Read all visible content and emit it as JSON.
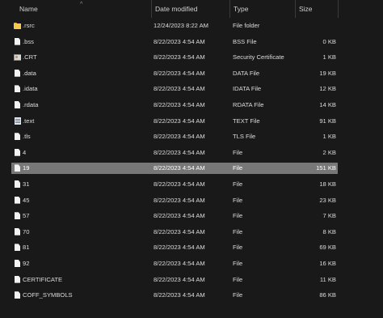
{
  "header": {
    "name": "Name",
    "date_modified": "Date modified",
    "type": "Type",
    "size": "Size",
    "sort_arrow": "^"
  },
  "files": [
    {
      "icon": "folder-icon",
      "name": ".rsrc",
      "date": "12/24/2023 8:22 AM",
      "type": "File folder",
      "size": ""
    },
    {
      "icon": "file-icon",
      "name": ".bss",
      "date": "8/22/2023 4:54 AM",
      "type": "BSS File",
      "size": "0 KB"
    },
    {
      "icon": "certificate-icon",
      "name": ".CRT",
      "date": "8/22/2023 4:54 AM",
      "type": "Security Certificate",
      "size": "1 KB"
    },
    {
      "icon": "file-icon",
      "name": ".data",
      "date": "8/22/2023 4:54 AM",
      "type": "DATA File",
      "size": "19 KB"
    },
    {
      "icon": "file-icon",
      "name": ".idata",
      "date": "8/22/2023 4:54 AM",
      "type": "IDATA File",
      "size": "12 KB"
    },
    {
      "icon": "file-icon",
      "name": ".rdata",
      "date": "8/22/2023 4:54 AM",
      "type": "RDATA File",
      "size": "14 KB"
    },
    {
      "icon": "text-file-icon",
      "name": ".text",
      "date": "8/22/2023 4:54 AM",
      "type": "TEXT File",
      "size": "91 KB"
    },
    {
      "icon": "file-icon",
      "name": ".tls",
      "date": "8/22/2023 4:54 AM",
      "type": "TLS File",
      "size": "1 KB"
    },
    {
      "icon": "file-icon",
      "name": "4",
      "date": "8/22/2023 4:54 AM",
      "type": "File",
      "size": "2 KB"
    },
    {
      "icon": "file-icon",
      "name": "19",
      "date": "8/22/2023 4:54 AM",
      "type": "File",
      "size": "151 KB",
      "selected": true
    },
    {
      "icon": "file-icon",
      "name": "31",
      "date": "8/22/2023 4:54 AM",
      "type": "File",
      "size": "18 KB"
    },
    {
      "icon": "file-icon",
      "name": "45",
      "date": "8/22/2023 4:54 AM",
      "type": "File",
      "size": "23 KB"
    },
    {
      "icon": "file-icon",
      "name": "57",
      "date": "8/22/2023 4:54 AM",
      "type": "File",
      "size": "7 KB"
    },
    {
      "icon": "file-icon",
      "name": "70",
      "date": "8/22/2023 4:54 AM",
      "type": "File",
      "size": "8 KB"
    },
    {
      "icon": "file-icon",
      "name": "81",
      "date": "8/22/2023 4:54 AM",
      "type": "File",
      "size": "69 KB"
    },
    {
      "icon": "file-icon",
      "name": "92",
      "date": "8/22/2023 4:54 AM",
      "type": "File",
      "size": "16 KB"
    },
    {
      "icon": "file-icon",
      "name": "CERTIFICATE",
      "date": "8/22/2023 4:54 AM",
      "type": "File",
      "size": "11 KB"
    },
    {
      "icon": "file-icon",
      "name": "COFF_SYMBOLS",
      "date": "8/22/2023 4:54 AM",
      "type": "File",
      "size": "86 KB"
    }
  ],
  "colors": {
    "background": "#191919",
    "selection": "#777777",
    "folder": "#f7c84b"
  }
}
